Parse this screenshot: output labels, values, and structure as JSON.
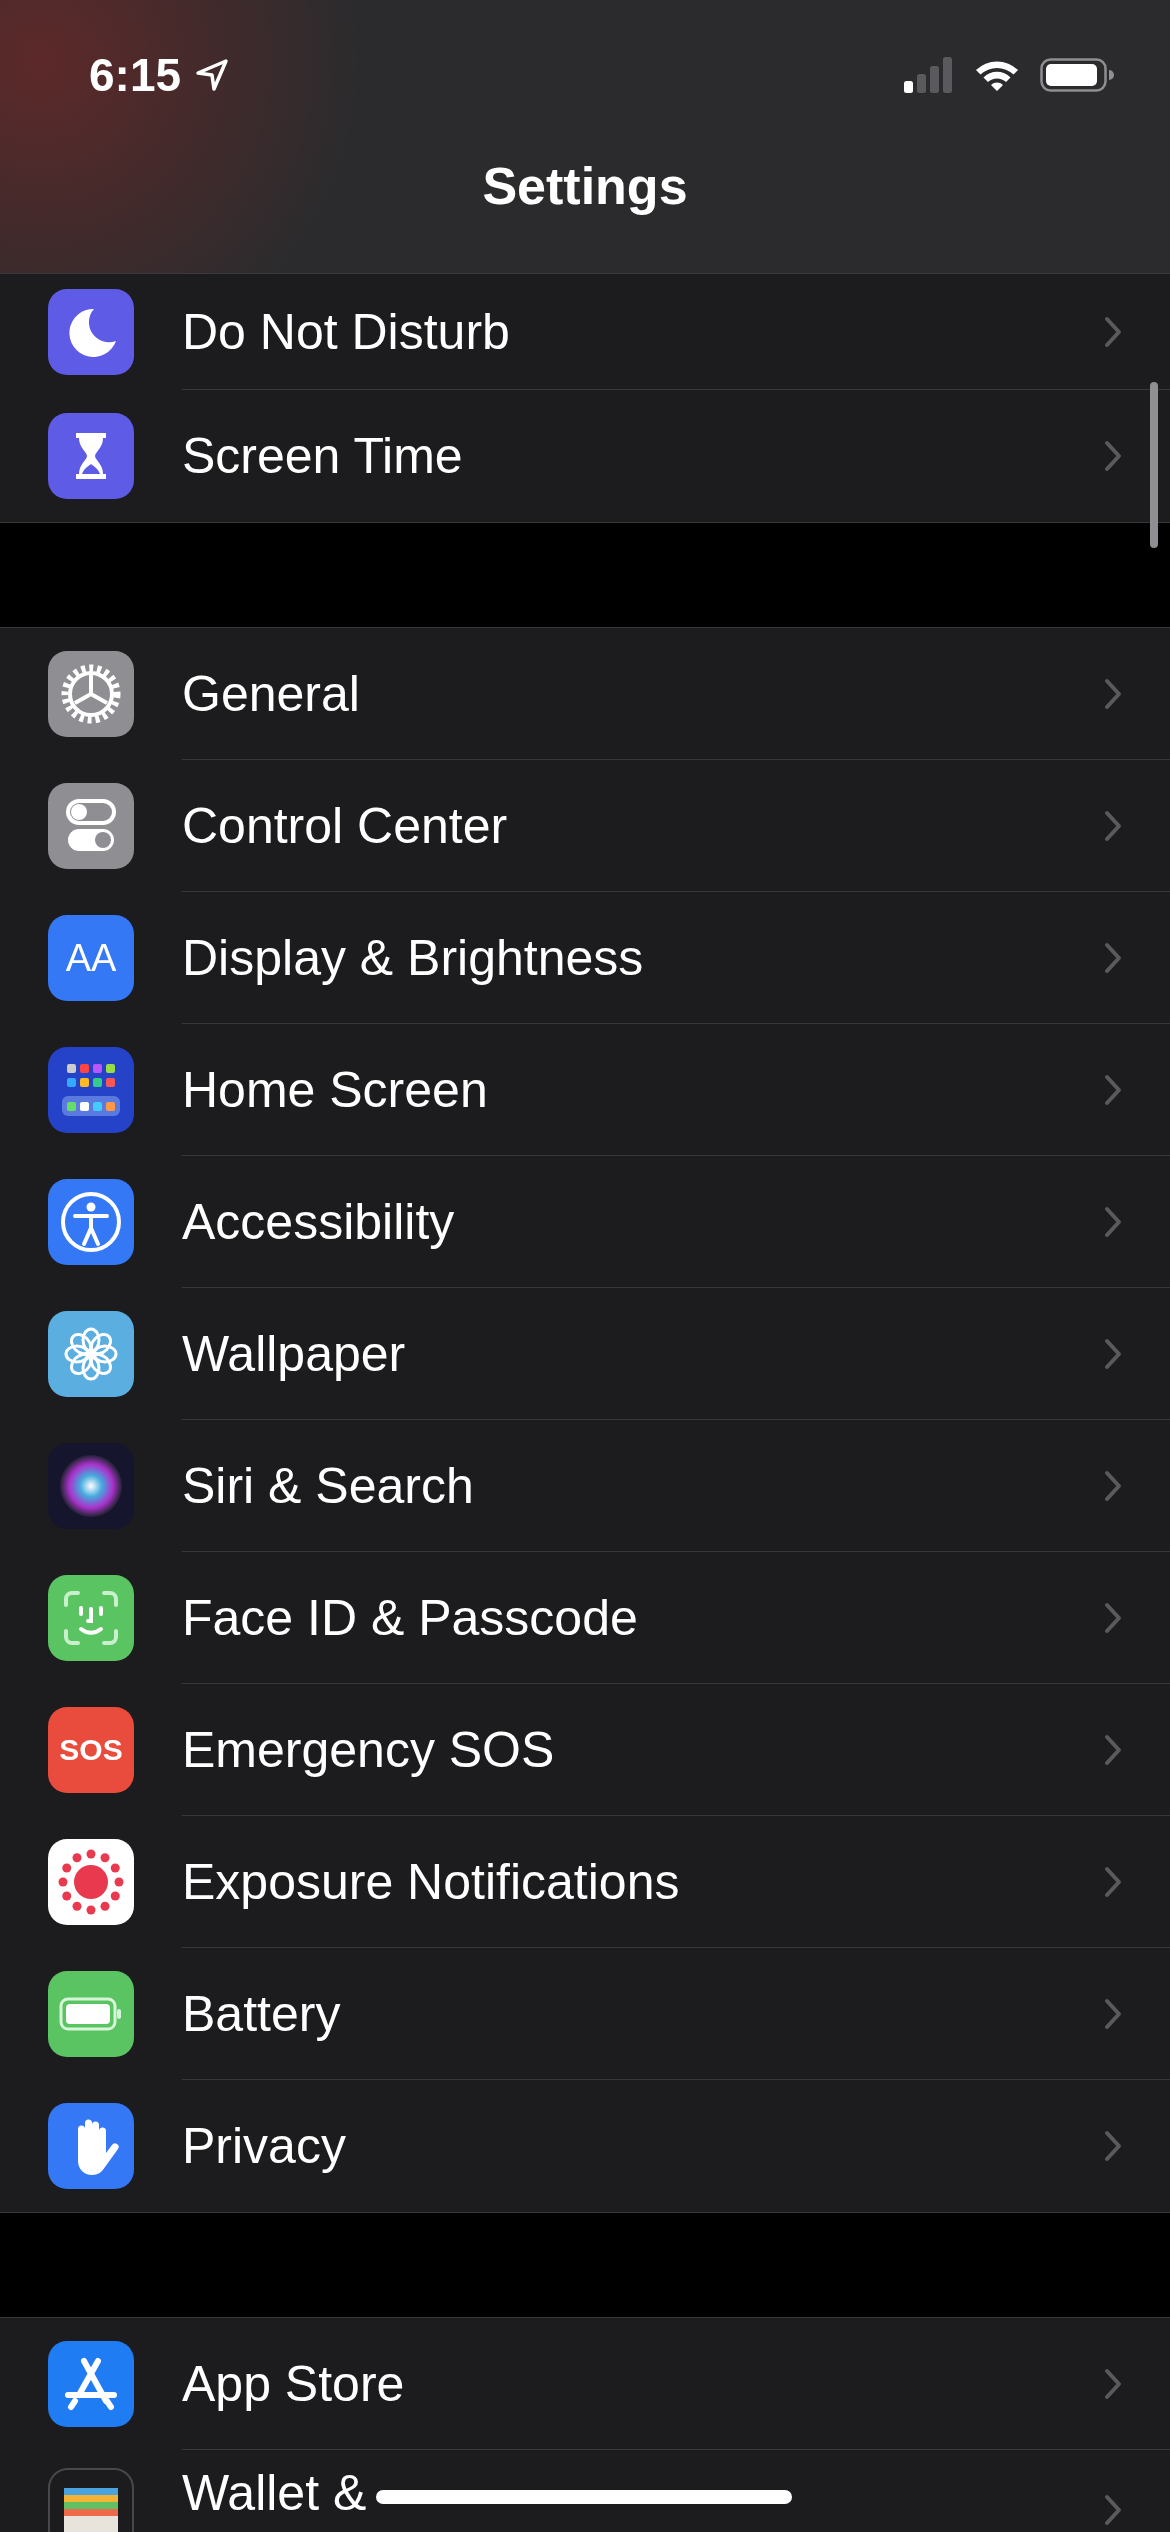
{
  "status_bar": {
    "time": "6:15"
  },
  "title": "Settings",
  "groups": [
    {
      "rows": [
        {
          "label": "Do Not Disturb"
        },
        {
          "label": "Screen Time"
        }
      ]
    },
    {
      "rows": [
        {
          "label": "General"
        },
        {
          "label": "Control Center"
        },
        {
          "label": "Display & Brightness",
          "icon_text": "AA"
        },
        {
          "label": "Home Screen"
        },
        {
          "label": "Accessibility"
        },
        {
          "label": "Wallpaper"
        },
        {
          "label": "Siri & Search"
        },
        {
          "label": "Face ID & Passcode"
        },
        {
          "label": "Emergency SOS",
          "icon_text": "SOS"
        },
        {
          "label": "Exposure Notifications"
        },
        {
          "label": "Battery"
        },
        {
          "label": "Privacy"
        }
      ]
    },
    {
      "rows": [
        {
          "label": "App Store"
        },
        {
          "label": "Wallet &"
        }
      ]
    }
  ]
}
